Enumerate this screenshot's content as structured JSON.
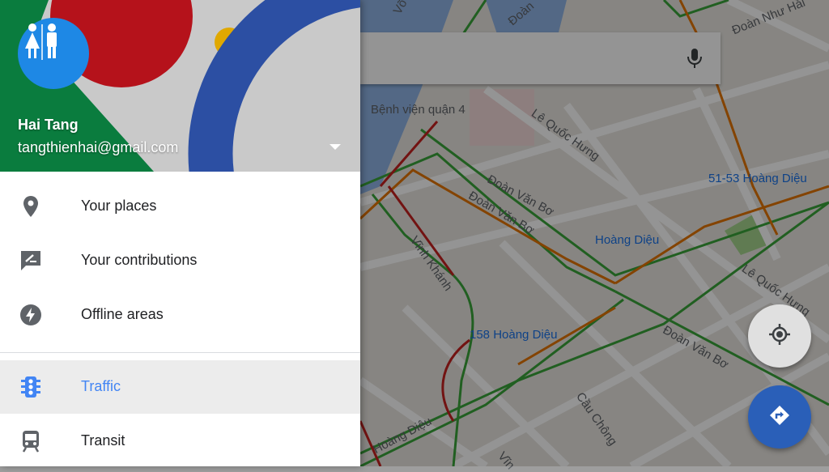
{
  "account": {
    "name": "Hai Tang",
    "email": "tangthienhai@gmail.com"
  },
  "menu": {
    "items": [
      {
        "label": "Your places",
        "icon": "place-pin-icon"
      },
      {
        "label": "Your contributions",
        "icon": "rate-review-icon"
      },
      {
        "label": "Offline areas",
        "icon": "offline-bolt-icon"
      },
      {
        "label": "Traffic",
        "icon": "traffic-light-icon",
        "active": true
      },
      {
        "label": "Transit",
        "icon": "train-icon"
      }
    ]
  },
  "map": {
    "labels": [
      "Bệnh viện quận 4",
      "Lê Quốc Hưng",
      "Đoàn Văn Bơ",
      "Đoàn Văn Bơ",
      "Vĩnh Khánh",
      "Hoàng Diệu",
      "51-53 Hoàng Diệu",
      "Lê Quốc Hưng",
      "158 Hoàng Diệu",
      "Đoàn Văn Bơ",
      "Cầu Chông",
      "Đoàn Như Hải",
      "Võ V",
      "Đoàn",
      "Hoàng Diệu",
      "Vĩn"
    ]
  },
  "colors": {
    "accent": "#4285f4",
    "fab_directions": "#1a73e8",
    "traffic_green": "#3aa43a",
    "traffic_orange": "#e37400",
    "traffic_red": "#c5221f"
  }
}
